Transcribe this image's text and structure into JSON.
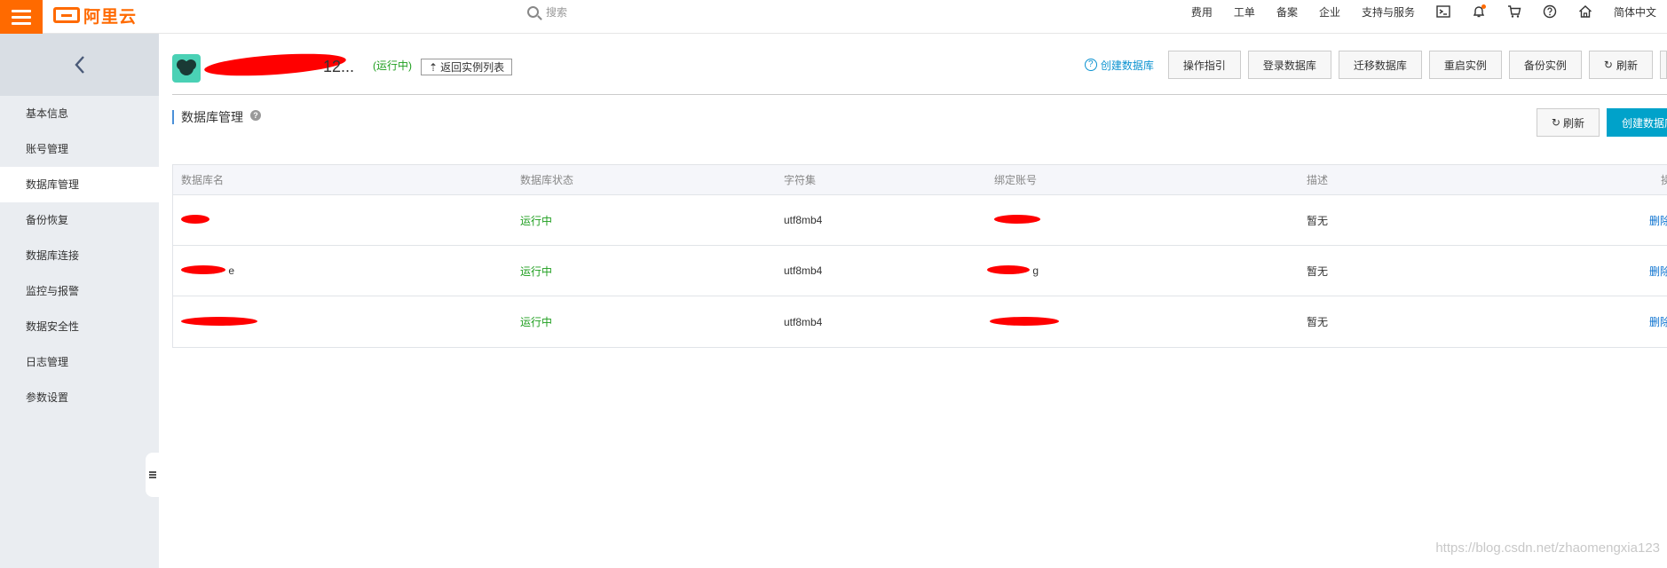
{
  "topbar": {
    "logo_text": "阿里云",
    "search_placeholder": "搜索",
    "nav": [
      "费用",
      "工单",
      "备案",
      "企业",
      "支持与服务"
    ],
    "icons": [
      "terminal-icon",
      "bell-icon",
      "cart-icon",
      "help-icon",
      "home-icon"
    ],
    "language": "简体中文"
  },
  "sidebar": {
    "items": [
      {
        "label": "基本信息"
      },
      {
        "label": "账号管理"
      },
      {
        "label": "数据库管理"
      },
      {
        "label": "备份恢复"
      },
      {
        "label": "数据库连接"
      },
      {
        "label": "监控与报警"
      },
      {
        "label": "数据安全性"
      },
      {
        "label": "日志管理"
      },
      {
        "label": "参数设置"
      }
    ],
    "active_index": 2
  },
  "header": {
    "instance_name_tail": "12...",
    "status": "(运行中)",
    "back_to_list": "返回实例列表",
    "help_link": "创建数据库",
    "actions": [
      "操作指引",
      "登录数据库",
      "迁移数据库",
      "重启实例",
      "备份实例",
      "刷新"
    ]
  },
  "section": {
    "title": "数据库管理",
    "refresh_label": "刷新",
    "create_label": "创建数据库"
  },
  "table": {
    "columns": [
      "数据库名",
      "数据库状态",
      "字符集",
      "绑定账号",
      "描述",
      "操"
    ],
    "rows": [
      {
        "name_tail": "",
        "status": "运行中",
        "charset": "utf8mb4",
        "account_tail": "",
        "desc": "暂无",
        "action": "删除"
      },
      {
        "name_tail": "e",
        "status": "运行中",
        "charset": "utf8mb4",
        "account_tail": "g",
        "desc": "暂无",
        "action": "删除"
      },
      {
        "name_tail": "",
        "status": "运行中",
        "charset": "utf8mb4",
        "account_tail": "",
        "desc": "暂无",
        "action": "删除"
      }
    ]
  },
  "watermark": "https://blog.csdn.net/zhaomengxia123",
  "colors": {
    "brand": "#ff6a00",
    "primary": "#00a2ca",
    "running": "#1e9e1e",
    "link": "#0b72d0",
    "sidebar_bg": "#eaedf1"
  }
}
